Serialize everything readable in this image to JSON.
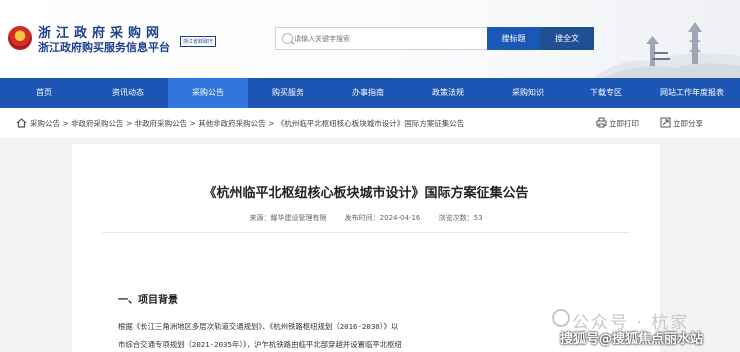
{
  "header": {
    "site_name": "浙江政府采购网",
    "site_subtitle": "浙江政府购买服务信息平台",
    "site_tag": "浙江省财政厅",
    "search": {
      "placeholder": "请输入关键字搜索",
      "search_title_label": "搜标题",
      "search_full_label": "搜全文"
    }
  },
  "nav": {
    "items": [
      {
        "label": "首页"
      },
      {
        "label": "资讯动态"
      },
      {
        "label": "采购公告"
      },
      {
        "label": "购买服务"
      },
      {
        "label": "办事指南"
      },
      {
        "label": "政策法规"
      },
      {
        "label": "采购知识"
      },
      {
        "label": "下载专区"
      },
      {
        "label": "网站工作年度报表"
      }
    ],
    "active_index": 2
  },
  "breadcrumb": {
    "items": [
      "采购公告",
      "非政府采购公告",
      "非政府采购公告",
      "其他非政府采购公告",
      "《杭州临平北枢纽核心板块城市设计》国际方案征集公告"
    ],
    "separator": " > "
  },
  "tools": {
    "print_label": "立即打印",
    "share_label": "立即分享"
  },
  "article": {
    "title": "《杭州临平北枢纽核心板块城市设计》国际方案征集公告",
    "source": "来源：耀华建设管理有限",
    "publish_time": "发布时间：2024-04-16",
    "views": "浏览次数：53",
    "section_heading": "一、项目背景",
    "para_line1": "根据《长江三角洲地区多层次轨道交通规划》、《杭州铁路枢纽规划（2016-2030）》以",
    "para_line2": "市综合交通专项规划（2021-2035年）》，沪乍杭铁路由临平北部穿越并设置临平北枢纽"
  },
  "watermark": {
    "top": "公众号 · 杭家",
    "bottom": "搜狐号@搜狐焦点丽水站"
  },
  "colors": {
    "nav_bg": "#1c55b4",
    "nav_active": "#3176dd",
    "brand_text": "#1d3f8f"
  }
}
